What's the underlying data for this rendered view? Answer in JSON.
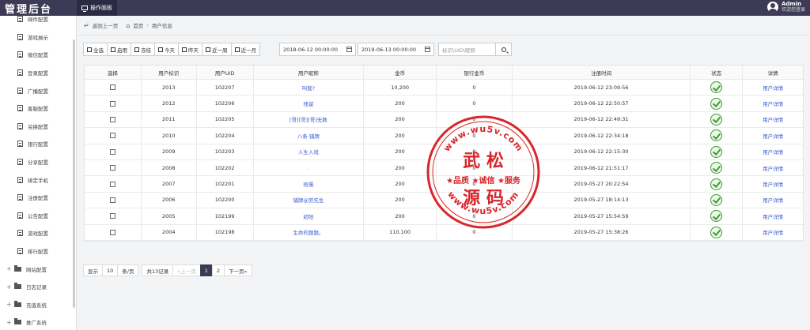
{
  "app": {
    "logo": "管理后台",
    "top_tab": "操作面板",
    "user_name": "Admin",
    "user_sub": "欢迎您登录"
  },
  "sidebar": {
    "items": [
      {
        "label": "邮件配置",
        "type": "sub"
      },
      {
        "label": "游戏展示",
        "type": "sub"
      },
      {
        "label": "微信配置",
        "type": "sub"
      },
      {
        "label": "登录配置",
        "type": "sub"
      },
      {
        "label": "广播配置",
        "type": "sub"
      },
      {
        "label": "客服配置",
        "type": "sub"
      },
      {
        "label": "兑换配置",
        "type": "sub"
      },
      {
        "label": "银行配置",
        "type": "sub"
      },
      {
        "label": "分享配置",
        "type": "sub"
      },
      {
        "label": "绑定手机",
        "type": "sub"
      },
      {
        "label": "注册配置",
        "type": "sub"
      },
      {
        "label": "公告配置",
        "type": "sub"
      },
      {
        "label": "游戏配置",
        "type": "sub"
      },
      {
        "label": "排行配置",
        "type": "sub"
      },
      {
        "label": "网站配置",
        "type": "group"
      },
      {
        "label": "日志记录",
        "type": "group"
      },
      {
        "label": "充值系统",
        "type": "group"
      },
      {
        "label": "推广系统",
        "type": "group"
      }
    ]
  },
  "breadcrumb": {
    "back": "返回上一页",
    "home": "首页",
    "current": "用户信息",
    "sep": "›"
  },
  "toolbar": {
    "buttons": [
      "全选",
      "启用",
      "冻结",
      "今天",
      "昨天",
      "近一周",
      "近一月"
    ],
    "date_start": "2018-06-12 00:00:00",
    "date_end": "2019-06-13 00:00:00",
    "search_placeholder": "标识\\UID\\昵称"
  },
  "table": {
    "headers": [
      "选择",
      "用户标识",
      "用户UID",
      "用户昵称",
      "金币",
      "银行金币",
      "注册时间",
      "状态",
      "详情"
    ],
    "rows": [
      {
        "id": "2013",
        "uid": "102207",
        "nick": "叫我?",
        "coin": "10,200",
        "bank": "0",
        "time": "2019-06-12 23:09:56",
        "detail": "用户详情"
      },
      {
        "id": "2012",
        "uid": "102206",
        "nick": "残留",
        "coin": "200",
        "bank": "0",
        "time": "2019-06-12 22:50:57",
        "detail": "用户详情"
      },
      {
        "id": "2011",
        "uid": "102205",
        "nick": "[哥][哥][哥]无数",
        "coin": "200",
        "bank": "0",
        "time": "2019-06-12 22:49:31",
        "detail": "用户详情"
      },
      {
        "id": "2010",
        "uid": "102204",
        "nick": "八条·铺牌",
        "coin": "200",
        "bank": "0",
        "time": "2019-06-12 22:34:18",
        "detail": "用户详情"
      },
      {
        "id": "2009",
        "uid": "102203",
        "nick": "人生入戏",
        "coin": "200",
        "bank": "0",
        "time": "2019-06-12 22:15:30",
        "detail": "用户详情"
      },
      {
        "id": "2008",
        "uid": "102202",
        "nick": ".",
        "coin": "200",
        "bank": "0",
        "time": "2019-06-12 21:51:17",
        "detail": "用户详情"
      },
      {
        "id": "2007",
        "uid": "102201",
        "nick": "晗儒",
        "coin": "200",
        "bank": "0",
        "time": "2019-05-27 20:22:54",
        "detail": "用户详情"
      },
      {
        "id": "2006",
        "uid": "102200",
        "nick": "铺牌@劳先生",
        "coin": "200",
        "bank": "0",
        "time": "2019-05-27 18:14:13",
        "detail": "用户详情"
      },
      {
        "id": "2005",
        "uid": "102199",
        "nick": "初阳",
        "coin": "200",
        "bank": "0",
        "time": "2019-05-27 15:54:59",
        "detail": "用户详情"
      },
      {
        "id": "2004",
        "uid": "102198",
        "nick": "生命的题题。",
        "coin": "110,100",
        "bank": "0",
        "time": "2019-05-27 15:38:26",
        "detail": "用户详情"
      }
    ]
  },
  "pager": {
    "show": "显示",
    "per_page": "10",
    "unit": "条/页",
    "total": "共13记录",
    "prev": "«上一页",
    "pages": [
      "1",
      "2"
    ],
    "next": "下一页»"
  },
  "watermark": {
    "top_text": "www.wu5v.com",
    "bottom_text": "www.wu5v.com",
    "line1": "武 松",
    "line2": "★品质 ★诚信 ★服务",
    "line3": "源 码",
    "color": "#d8262a"
  },
  "colors": {
    "topbar": "#3c3a55",
    "link": "#3b5bd0",
    "status_ok": "#3a9a2e"
  }
}
